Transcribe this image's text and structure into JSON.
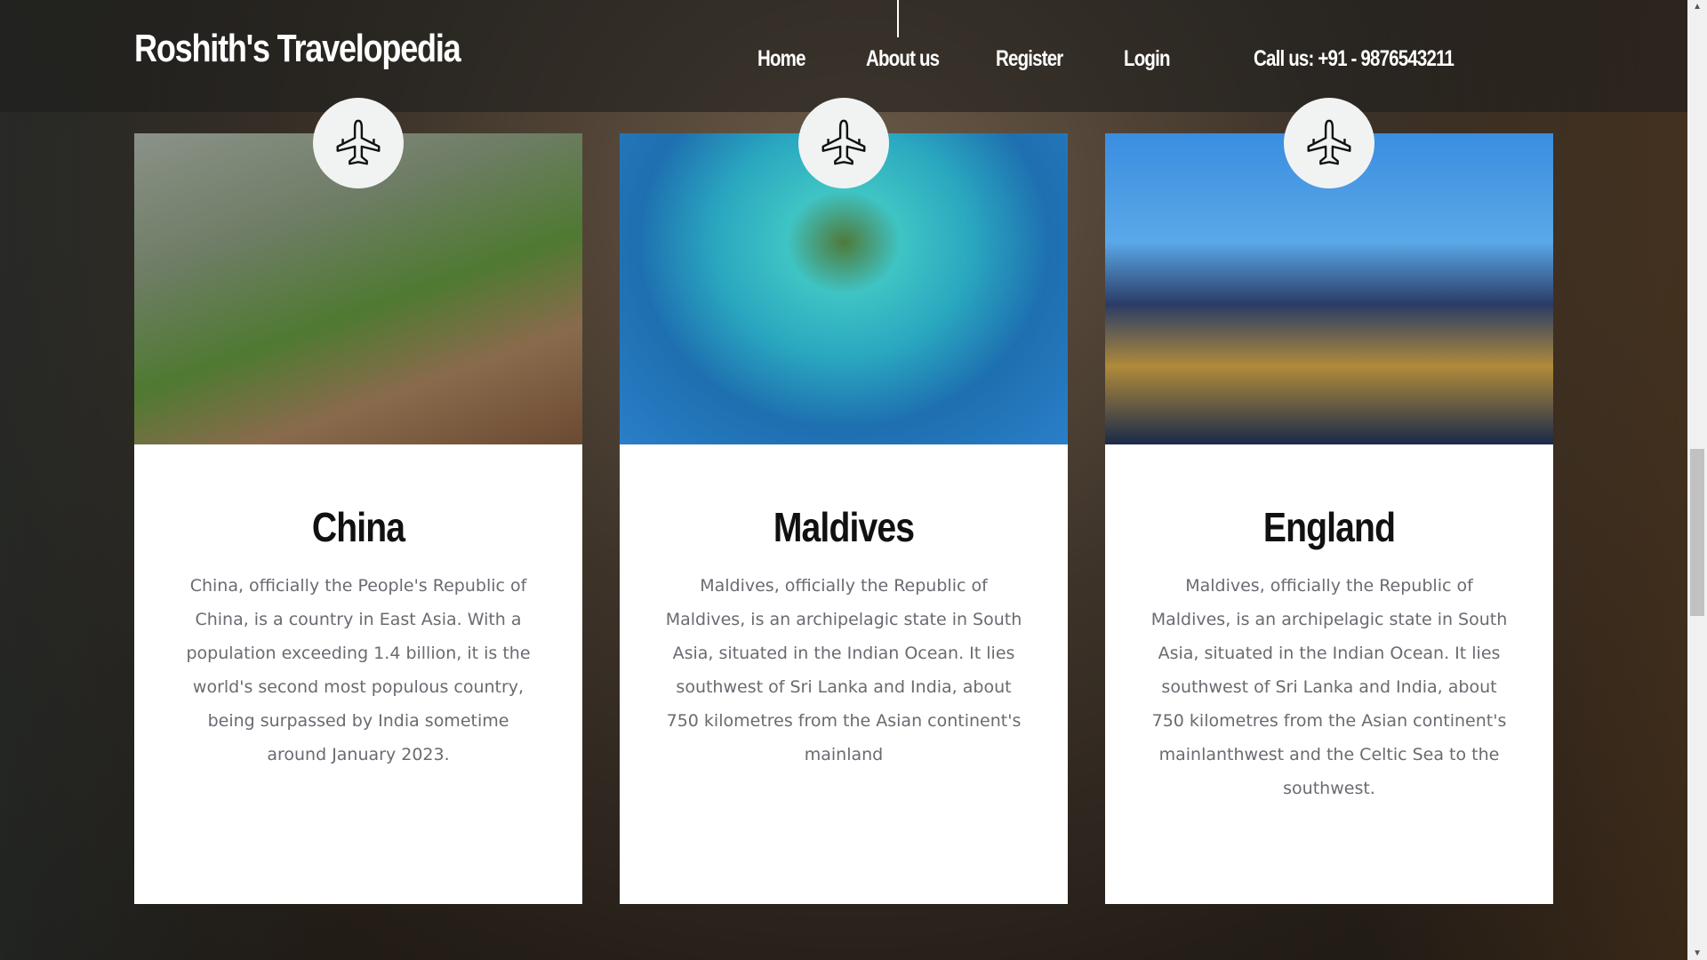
{
  "header": {
    "brand": "Roshith's Travelopedia",
    "nav": [
      "Home",
      "About us",
      "Register",
      "Login"
    ],
    "phone": "Call us: +91 - 9876543211"
  },
  "cards": [
    {
      "title": "China",
      "icon": "airplane-icon",
      "text": "China, officially the People's Republic of China, is a country in East Asia. With a population exceeding 1.4 billion, it is the world's second most populous country, being surpassed by India sometime around January 2023."
    },
    {
      "title": "Maldives",
      "icon": "airplane-icon",
      "text": "Maldives, officially the Republic of Maldives, is an archipelagic state in South Asia, situated in the Indian Ocean. It lies southwest of Sri Lanka and India, about 750 kilometres from the Asian continent's mainland"
    },
    {
      "title": "England",
      "icon": "airplane-icon",
      "text": "Maldives, officially the Republic of Maldives, is an archipelagic state in South Asia, situated in the Indian Ocean. It lies southwest of Sri Lanka and India, about 750 kilometres from the Asian continent's mainlanthwest and the Celtic Sea to the southwest."
    }
  ]
}
